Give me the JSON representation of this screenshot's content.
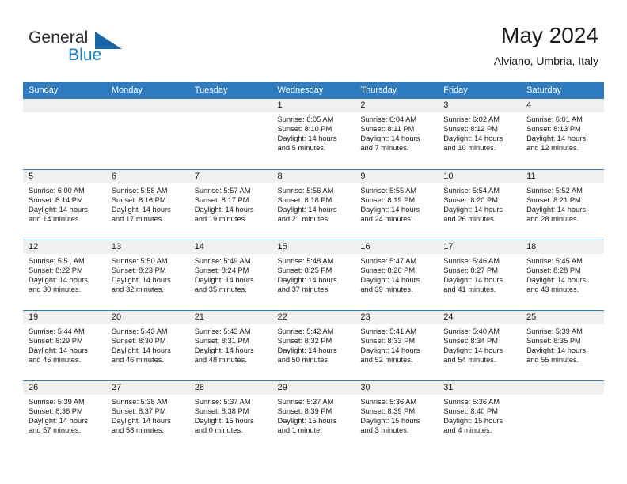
{
  "brand": {
    "name_part1": "General",
    "name_part2": "Blue",
    "logo_icon": "triangle-logo-icon"
  },
  "header": {
    "title": "May 2024",
    "subtitle": "Alviano, Umbria, Italy"
  },
  "calendar": {
    "weekday_headers": [
      "Sunday",
      "Monday",
      "Tuesday",
      "Wednesday",
      "Thursday",
      "Friday",
      "Saturday"
    ],
    "colors": {
      "header_blue": "#2e7cbf",
      "daynum_band": "#f0f0f0",
      "brand_blue": "#1b7fc4",
      "logo_blue": "#1565a8",
      "text": "#1a1a1a"
    },
    "weeks": [
      [
        {
          "day": "",
          "empty": true
        },
        {
          "day": "",
          "empty": true
        },
        {
          "day": "",
          "empty": true
        },
        {
          "day": "1",
          "sunrise": "Sunrise: 6:05 AM",
          "sunset": "Sunset: 8:10 PM",
          "daylight_line1": "Daylight: 14 hours",
          "daylight_line2": "and 5 minutes."
        },
        {
          "day": "2",
          "sunrise": "Sunrise: 6:04 AM",
          "sunset": "Sunset: 8:11 PM",
          "daylight_line1": "Daylight: 14 hours",
          "daylight_line2": "and 7 minutes."
        },
        {
          "day": "3",
          "sunrise": "Sunrise: 6:02 AM",
          "sunset": "Sunset: 8:12 PM",
          "daylight_line1": "Daylight: 14 hours",
          "daylight_line2": "and 10 minutes."
        },
        {
          "day": "4",
          "sunrise": "Sunrise: 6:01 AM",
          "sunset": "Sunset: 8:13 PM",
          "daylight_line1": "Daylight: 14 hours",
          "daylight_line2": "and 12 minutes."
        }
      ],
      [
        {
          "day": "5",
          "sunrise": "Sunrise: 6:00 AM",
          "sunset": "Sunset: 8:14 PM",
          "daylight_line1": "Daylight: 14 hours",
          "daylight_line2": "and 14 minutes."
        },
        {
          "day": "6",
          "sunrise": "Sunrise: 5:58 AM",
          "sunset": "Sunset: 8:16 PM",
          "daylight_line1": "Daylight: 14 hours",
          "daylight_line2": "and 17 minutes."
        },
        {
          "day": "7",
          "sunrise": "Sunrise: 5:57 AM",
          "sunset": "Sunset: 8:17 PM",
          "daylight_line1": "Daylight: 14 hours",
          "daylight_line2": "and 19 minutes."
        },
        {
          "day": "8",
          "sunrise": "Sunrise: 5:56 AM",
          "sunset": "Sunset: 8:18 PM",
          "daylight_line1": "Daylight: 14 hours",
          "daylight_line2": "and 21 minutes."
        },
        {
          "day": "9",
          "sunrise": "Sunrise: 5:55 AM",
          "sunset": "Sunset: 8:19 PM",
          "daylight_line1": "Daylight: 14 hours",
          "daylight_line2": "and 24 minutes."
        },
        {
          "day": "10",
          "sunrise": "Sunrise: 5:54 AM",
          "sunset": "Sunset: 8:20 PM",
          "daylight_line1": "Daylight: 14 hours",
          "daylight_line2": "and 26 minutes."
        },
        {
          "day": "11",
          "sunrise": "Sunrise: 5:52 AM",
          "sunset": "Sunset: 8:21 PM",
          "daylight_line1": "Daylight: 14 hours",
          "daylight_line2": "and 28 minutes."
        }
      ],
      [
        {
          "day": "12",
          "sunrise": "Sunrise: 5:51 AM",
          "sunset": "Sunset: 8:22 PM",
          "daylight_line1": "Daylight: 14 hours",
          "daylight_line2": "and 30 minutes."
        },
        {
          "day": "13",
          "sunrise": "Sunrise: 5:50 AM",
          "sunset": "Sunset: 8:23 PM",
          "daylight_line1": "Daylight: 14 hours",
          "daylight_line2": "and 32 minutes."
        },
        {
          "day": "14",
          "sunrise": "Sunrise: 5:49 AM",
          "sunset": "Sunset: 8:24 PM",
          "daylight_line1": "Daylight: 14 hours",
          "daylight_line2": "and 35 minutes."
        },
        {
          "day": "15",
          "sunrise": "Sunrise: 5:48 AM",
          "sunset": "Sunset: 8:25 PM",
          "daylight_line1": "Daylight: 14 hours",
          "daylight_line2": "and 37 minutes."
        },
        {
          "day": "16",
          "sunrise": "Sunrise: 5:47 AM",
          "sunset": "Sunset: 8:26 PM",
          "daylight_line1": "Daylight: 14 hours",
          "daylight_line2": "and 39 minutes."
        },
        {
          "day": "17",
          "sunrise": "Sunrise: 5:46 AM",
          "sunset": "Sunset: 8:27 PM",
          "daylight_line1": "Daylight: 14 hours",
          "daylight_line2": "and 41 minutes."
        },
        {
          "day": "18",
          "sunrise": "Sunrise: 5:45 AM",
          "sunset": "Sunset: 8:28 PM",
          "daylight_line1": "Daylight: 14 hours",
          "daylight_line2": "and 43 minutes."
        }
      ],
      [
        {
          "day": "19",
          "sunrise": "Sunrise: 5:44 AM",
          "sunset": "Sunset: 8:29 PM",
          "daylight_line1": "Daylight: 14 hours",
          "daylight_line2": "and 45 minutes."
        },
        {
          "day": "20",
          "sunrise": "Sunrise: 5:43 AM",
          "sunset": "Sunset: 8:30 PM",
          "daylight_line1": "Daylight: 14 hours",
          "daylight_line2": "and 46 minutes."
        },
        {
          "day": "21",
          "sunrise": "Sunrise: 5:43 AM",
          "sunset": "Sunset: 8:31 PM",
          "daylight_line1": "Daylight: 14 hours",
          "daylight_line2": "and 48 minutes."
        },
        {
          "day": "22",
          "sunrise": "Sunrise: 5:42 AM",
          "sunset": "Sunset: 8:32 PM",
          "daylight_line1": "Daylight: 14 hours",
          "daylight_line2": "and 50 minutes."
        },
        {
          "day": "23",
          "sunrise": "Sunrise: 5:41 AM",
          "sunset": "Sunset: 8:33 PM",
          "daylight_line1": "Daylight: 14 hours",
          "daylight_line2": "and 52 minutes."
        },
        {
          "day": "24",
          "sunrise": "Sunrise: 5:40 AM",
          "sunset": "Sunset: 8:34 PM",
          "daylight_line1": "Daylight: 14 hours",
          "daylight_line2": "and 54 minutes."
        },
        {
          "day": "25",
          "sunrise": "Sunrise: 5:39 AM",
          "sunset": "Sunset: 8:35 PM",
          "daylight_line1": "Daylight: 14 hours",
          "daylight_line2": "and 55 minutes."
        }
      ],
      [
        {
          "day": "26",
          "sunrise": "Sunrise: 5:39 AM",
          "sunset": "Sunset: 8:36 PM",
          "daylight_line1": "Daylight: 14 hours",
          "daylight_line2": "and 57 minutes."
        },
        {
          "day": "27",
          "sunrise": "Sunrise: 5:38 AM",
          "sunset": "Sunset: 8:37 PM",
          "daylight_line1": "Daylight: 14 hours",
          "daylight_line2": "and 58 minutes."
        },
        {
          "day": "28",
          "sunrise": "Sunrise: 5:37 AM",
          "sunset": "Sunset: 8:38 PM",
          "daylight_line1": "Daylight: 15 hours",
          "daylight_line2": "and 0 minutes."
        },
        {
          "day": "29",
          "sunrise": "Sunrise: 5:37 AM",
          "sunset": "Sunset: 8:39 PM",
          "daylight_line1": "Daylight: 15 hours",
          "daylight_line2": "and 1 minute."
        },
        {
          "day": "30",
          "sunrise": "Sunrise: 5:36 AM",
          "sunset": "Sunset: 8:39 PM",
          "daylight_line1": "Daylight: 15 hours",
          "daylight_line2": "and 3 minutes."
        },
        {
          "day": "31",
          "sunrise": "Sunrise: 5:36 AM",
          "sunset": "Sunset: 8:40 PM",
          "daylight_line1": "Daylight: 15 hours",
          "daylight_line2": "and 4 minutes."
        },
        {
          "day": "",
          "empty": true
        }
      ]
    ]
  }
}
